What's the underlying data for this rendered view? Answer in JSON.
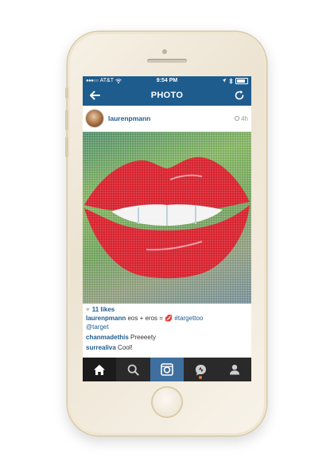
{
  "status_bar": {
    "carrier": "AT&T",
    "time": "9:54 PM"
  },
  "nav": {
    "title": "PHOTO"
  },
  "post": {
    "username": "laurenpmann",
    "time": "4h",
    "likes": "11 likes",
    "caption_user": "laurenpmann",
    "caption_text": "eos + eros =",
    "caption_tag": "#targettoo",
    "caption_mention": "@target"
  },
  "comments": [
    {
      "user": "chanmadethis",
      "text": "Preeeety"
    },
    {
      "user": "surrealiva",
      "text": "Cool!"
    }
  ],
  "icons": {
    "back": "back-arrow-icon",
    "refresh": "refresh-icon",
    "home": "home-icon",
    "search": "search-icon",
    "camera": "camera-icon",
    "activity": "activity-icon",
    "profile": "profile-icon"
  },
  "colors": {
    "brand": "#1e5c8e",
    "tabbar": "#2a2a2a",
    "camera_tab": "#3f6f9e",
    "notification": "#e07b39",
    "phone_gold": "#ece3d1"
  }
}
